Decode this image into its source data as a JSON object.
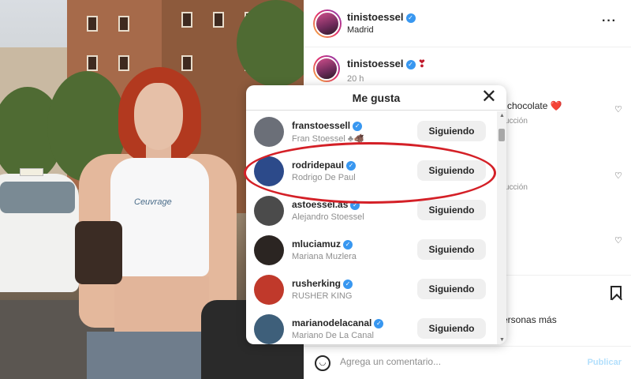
{
  "post_header": {
    "username": "tinistoessel",
    "location": "Madrid",
    "more_icon": "more-horizontal-icon"
  },
  "caption": {
    "username": "tinistoessel",
    "emoji": "❣",
    "time": "20 h"
  },
  "comments_background": [
    {
      "text": "chocolate ❤️",
      "reply": "ucción"
    },
    {
      "text": "",
      "reply": "ucción"
    }
  ],
  "likes_fragment": "ersonas más",
  "comment_box": {
    "placeholder": "Agrega un comentario...",
    "publish_label": "Publicar"
  },
  "likes_modal": {
    "title": "Me gusta",
    "close_icon": "close-icon",
    "users": [
      {
        "username": "franstoessell",
        "name": "Fran Stoessel ♣🐗",
        "button": "Siguiendo",
        "avatar_color": "#6b6f78"
      },
      {
        "username": "rodridepaul",
        "name": "Rodrigo De Paul",
        "button": "Siguiendo",
        "avatar_color": "#2c4a8a"
      },
      {
        "username": "astoessel.as",
        "name": "Alejandro Stoessel",
        "button": "Siguiendo",
        "avatar_color": "#4b4b4b"
      },
      {
        "username": "mluciamuz",
        "name": "Mariana Muzlera",
        "button": "Siguiendo",
        "avatar_color": "#2b2522"
      },
      {
        "username": "rusherking",
        "name": "RUSHER KING",
        "button": "Siguiendo",
        "avatar_color": "#c0392b"
      },
      {
        "username": "marianodelacanal",
        "name": "Mariano De La Canal",
        "button": "Siguiendo",
        "avatar_color": "#3e5f7a"
      }
    ]
  },
  "highlight_color": "#d42027",
  "photo_top_print": "Ceuvrage"
}
